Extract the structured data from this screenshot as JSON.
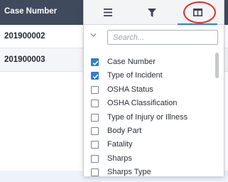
{
  "grid": {
    "header": {
      "case_number": "Case Number"
    },
    "rows": [
      {
        "case_number": "201900002"
      },
      {
        "case_number": "201900003"
      }
    ]
  },
  "column_menu": {
    "tabs": [
      {
        "icon": "menu-icon",
        "active": false
      },
      {
        "icon": "filter-icon",
        "active": false
      },
      {
        "icon": "columns-icon",
        "active": true
      }
    ],
    "search": {
      "placeholder": "Search...",
      "value": ""
    },
    "items": [
      {
        "label": "Case Number",
        "checked": true
      },
      {
        "label": "Type of Incident",
        "checked": true
      },
      {
        "label": "OSHA Status",
        "checked": false
      },
      {
        "label": "OSHA Classification",
        "checked": false
      },
      {
        "label": "Type of Injury or Illness",
        "checked": false
      },
      {
        "label": "Body Part",
        "checked": false
      },
      {
        "label": "Fatality",
        "checked": false
      },
      {
        "label": "Sharps",
        "checked": false
      },
      {
        "label": "Sharps Type",
        "checked": false
      }
    ]
  },
  "colors": {
    "header_bg": "#3f4a5c",
    "accent": "#2d7fd1",
    "highlight_ring": "#d9342b"
  }
}
